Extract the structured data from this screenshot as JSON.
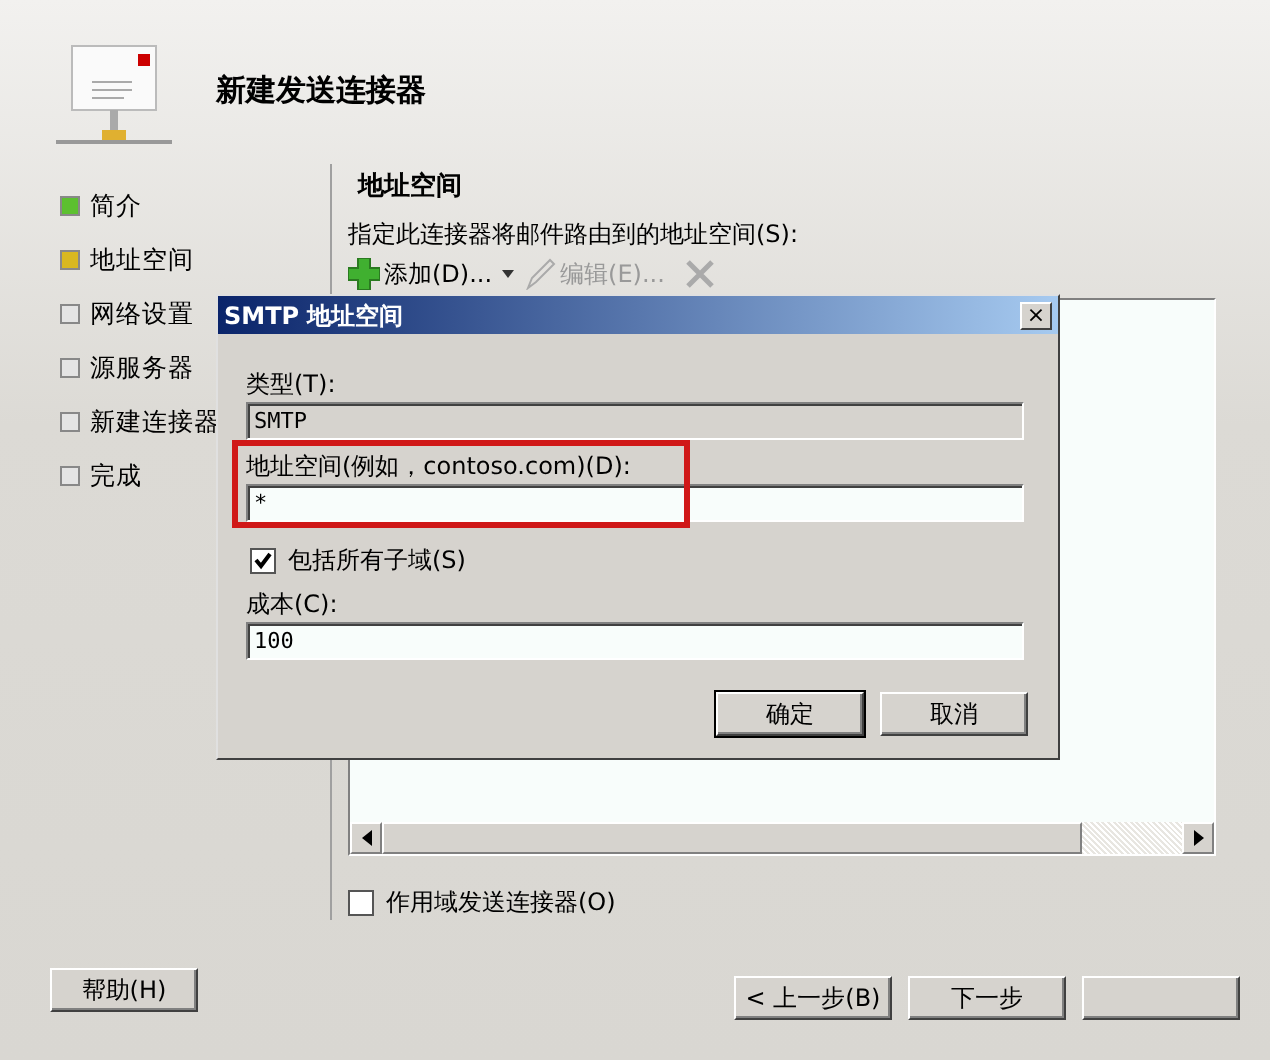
{
  "wizard": {
    "title": "新建发送连接器",
    "steps": [
      {
        "label": "简介",
        "completed": true,
        "selected": false
      },
      {
        "label": "地址空间",
        "completed": false,
        "selected": true
      },
      {
        "label": "网络设置",
        "completed": false,
        "selected": false
      },
      {
        "label": "源服务器",
        "completed": false,
        "selected": false
      },
      {
        "label": "新建连接器",
        "completed": false,
        "selected": false
      },
      {
        "label": "完成",
        "completed": false,
        "selected": false
      }
    ],
    "page": {
      "heading": "地址空间",
      "description": "指定此连接器将邮件路由到的地址空间(S):",
      "toolbar": [
        {
          "kind": "add",
          "label": "添加(D)...",
          "disabled": false
        },
        {
          "kind": "dropdown",
          "disabled": false
        },
        {
          "kind": "edit",
          "label": "编辑(E)...",
          "disabled": true
        },
        {
          "kind": "delete",
          "disabled": true
        }
      ],
      "scoped_checkbox": {
        "label": "作用域发送连接器(O)",
        "checked": false
      }
    },
    "help_button": "帮助(H)",
    "nav_buttons": [
      {
        "kind": "text",
        "label": "< 上一步(B)"
      },
      {
        "kind": "text",
        "label": "下一步"
      },
      {
        "kind": "blank"
      }
    ]
  },
  "dialog": {
    "title": "SMTP 地址空间",
    "close": "×",
    "items": [
      {
        "kind": "field",
        "label": "类型(T):",
        "value": "SMTP",
        "disabled": true,
        "highlighted": false
      },
      {
        "kind": "field",
        "label": "地址空间(例如，contoso.com)(D):",
        "value": "*",
        "disabled": false,
        "highlighted": true
      },
      {
        "kind": "checkbox",
        "label": "包括所有子域(S)",
        "checked": true
      },
      {
        "kind": "field",
        "label": "成本(C):",
        "value": "100",
        "disabled": false,
        "highlighted": false
      }
    ],
    "buttons": [
      {
        "label": "确定",
        "default": true
      },
      {
        "label": "取消",
        "default": false
      }
    ]
  }
}
